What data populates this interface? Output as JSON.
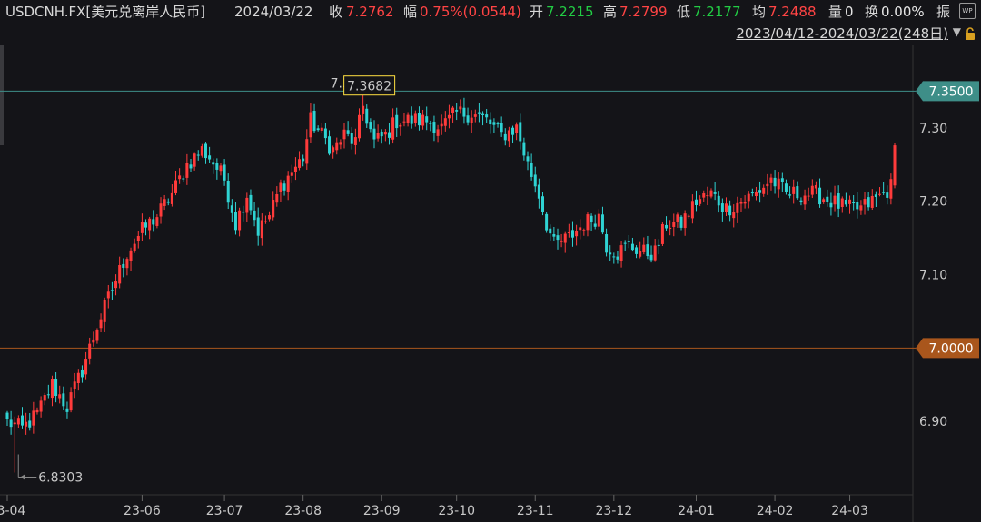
{
  "header": {
    "symbol": "USDCNH.FX[美元兑离岸人民币]",
    "date": "2024/03/22",
    "close_label": "收",
    "close": "7.2762",
    "change_label": "幅",
    "change": "0.75%(0.0544)",
    "open_label": "开",
    "open": "7.2215",
    "high_label": "高",
    "high": "7.2799",
    "low_label": "低",
    "low": "7.2177",
    "avg_label": "均",
    "avg": "7.2488",
    "vol_label": "量",
    "vol": "0",
    "turnover_label": "换",
    "turnover": "0.00%",
    "amp_label": "振",
    "range": "2023/04/12-2024/03/22(248日)",
    "wp_icon_text": "WP"
  },
  "colors": {
    "up": "#ff3b3b",
    "down": "#2fd3d3",
    "line_7350": "#5aa6a0",
    "line_7000": "#b85a1e",
    "max_label": "#ffe040",
    "min_label": "#22cc44"
  },
  "chart_data": {
    "type": "candlestick",
    "title": "USDCNH.FX[美元兑离岸人民币]",
    "ylim": [
      6.8,
      7.4
    ],
    "y_ticks": [
      "7.30",
      "7.20",
      "7.10",
      "6.90"
    ],
    "x_ticks": [
      "23-04",
      "23-06",
      "23-07",
      "23-08",
      "23-09",
      "23-10",
      "23-11",
      "23-12",
      "24-01",
      "24-02",
      "24-03"
    ],
    "x_tick_index": [
      0,
      36,
      58,
      79,
      100,
      120,
      141,
      162,
      184,
      205,
      225
    ],
    "horizontal_lines": [
      {
        "value": 7.35,
        "label": "7.3500",
        "color": "#3e8e88"
      },
      {
        "value": 7.0,
        "label": "7.0000",
        "color": "#a9561c"
      }
    ],
    "max_annotation": {
      "value": 7.3682,
      "label": "7.3682",
      "overlap_label": "7.3682"
    },
    "min_annotation": {
      "value": 6.8303,
      "label": "6.8303"
    },
    "trajectory_anchors": [
      [
        0,
        6.9
      ],
      [
        4,
        6.89
      ],
      [
        8,
        6.91
      ],
      [
        12,
        6.95
      ],
      [
        16,
        6.92
      ],
      [
        20,
        6.97
      ],
      [
        24,
        7.03
      ],
      [
        28,
        7.08
      ],
      [
        32,
        7.13
      ],
      [
        36,
        7.16
      ],
      [
        40,
        7.18
      ],
      [
        44,
        7.21
      ],
      [
        48,
        7.25
      ],
      [
        52,
        7.27
      ],
      [
        54,
        7.26
      ],
      [
        58,
        7.23
      ],
      [
        61,
        7.17
      ],
      [
        64,
        7.21
      ],
      [
        67,
        7.16
      ],
      [
        70,
        7.18
      ],
      [
        73,
        7.22
      ],
      [
        76,
        7.24
      ],
      [
        79,
        7.26
      ],
      [
        81,
        7.31
      ],
      [
        84,
        7.29
      ],
      [
        87,
        7.27
      ],
      [
        90,
        7.29
      ],
      [
        93,
        7.28
      ],
      [
        95,
        7.33
      ],
      [
        98,
        7.28
      ],
      [
        101,
        7.29
      ],
      [
        104,
        7.31
      ],
      [
        108,
        7.31
      ],
      [
        112,
        7.31
      ],
      [
        116,
        7.3
      ],
      [
        120,
        7.32
      ],
      [
        124,
        7.32
      ],
      [
        128,
        7.31
      ],
      [
        132,
        7.29
      ],
      [
        136,
        7.3
      ],
      [
        139,
        7.25
      ],
      [
        142,
        7.21
      ],
      [
        144,
        7.17
      ],
      [
        146,
        7.14
      ],
      [
        150,
        7.15
      ],
      [
        154,
        7.17
      ],
      [
        158,
        7.18
      ],
      [
        160,
        7.14
      ],
      [
        163,
        7.13
      ],
      [
        166,
        7.14
      ],
      [
        170,
        7.13
      ],
      [
        173,
        7.13
      ],
      [
        176,
        7.17
      ],
      [
        180,
        7.17
      ],
      [
        184,
        7.2
      ],
      [
        188,
        7.21
      ],
      [
        192,
        7.19
      ],
      [
        196,
        7.2
      ],
      [
        200,
        7.21
      ],
      [
        204,
        7.23
      ],
      [
        208,
        7.21
      ],
      [
        212,
        7.21
      ],
      [
        216,
        7.21
      ],
      [
        220,
        7.2
      ],
      [
        224,
        7.19
      ],
      [
        228,
        7.19
      ],
      [
        231,
        7.2
      ],
      [
        234,
        7.21
      ],
      [
        236,
        7.22
      ],
      [
        237,
        7.2762
      ]
    ]
  }
}
